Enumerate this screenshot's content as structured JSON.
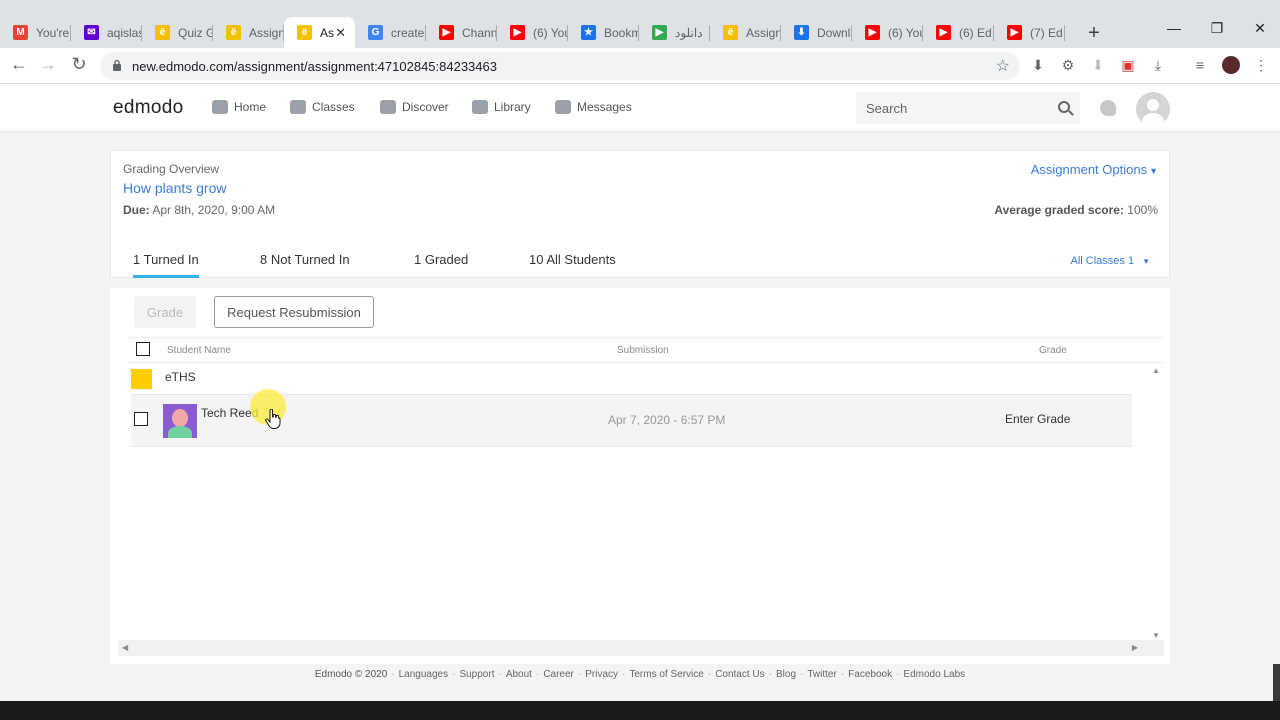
{
  "browser": {
    "tabs": [
      {
        "title": "You're",
        "icon": "gmail-icon",
        "color": "#ea4335",
        "glyph": "M"
      },
      {
        "title": "aqislas",
        "icon": "yahoo-mail-icon",
        "color": "#6001d2",
        "glyph": "✉"
      },
      {
        "title": "Quiz G",
        "icon": "edmodo-icon",
        "color": "#f2c200",
        "glyph": "ë"
      },
      {
        "title": "Assign",
        "icon": "edmodo-icon",
        "color": "#f2c200",
        "glyph": "ë"
      },
      {
        "title": "As",
        "icon": "edmodo-icon",
        "color": "#f2c200",
        "glyph": "ë",
        "active": true
      },
      {
        "title": "create",
        "icon": "google-icon",
        "color": "#4285f4",
        "glyph": "G"
      },
      {
        "title": "Chann",
        "icon": "youtube-icon",
        "color": "#ff0000",
        "glyph": "▶"
      },
      {
        "title": "(6) You",
        "icon": "youtube-icon",
        "color": "#ff0000",
        "glyph": "▶"
      },
      {
        "title": "Bookm",
        "icon": "bookmark-star-icon",
        "color": "#1a73e8",
        "glyph": "★"
      },
      {
        "title": "دانلود",
        "icon": "play-store-icon",
        "color": "#34a853",
        "glyph": "▶"
      },
      {
        "title": "Assign",
        "icon": "edmodo-icon",
        "color": "#f2c200",
        "glyph": "ë"
      },
      {
        "title": "Downl",
        "icon": "download-icon",
        "color": "#1a73e8",
        "glyph": "⬇"
      },
      {
        "title": "(6) You",
        "icon": "youtube-icon",
        "color": "#ff0000",
        "glyph": "▶"
      },
      {
        "title": "(6) Ed",
        "icon": "youtube-icon",
        "color": "#ff0000",
        "glyph": "▶"
      },
      {
        "title": "(7) Ed",
        "icon": "youtube-icon",
        "color": "#ff0000",
        "glyph": "▶"
      }
    ],
    "new_tab": "+",
    "minimize": "—",
    "restore": "❐",
    "close": "✕",
    "back": "←",
    "forward": "→",
    "reload": "↻",
    "url": "new.edmodo.com/assignment/assignment:47102845:84233463",
    "star": "☆",
    "menu": "⋮"
  },
  "header": {
    "logo": "edmodo",
    "nav": [
      {
        "label": "Home",
        "icon": "home-icon"
      },
      {
        "label": "Classes",
        "icon": "classes-icon"
      },
      {
        "label": "Discover",
        "icon": "discover-icon"
      },
      {
        "label": "Library",
        "icon": "library-icon"
      },
      {
        "label": "Messages",
        "icon": "messages-icon"
      }
    ],
    "search_placeholder": "Search"
  },
  "overview": {
    "label": "Grading Overview",
    "assignment_title": "How plants grow",
    "due_label": "Due:",
    "due_value": "Apr 8th, 2020, 9:00 AM",
    "options": "Assignment Options",
    "avg_label": "Average graded score:",
    "avg_value": "100%",
    "tabs": [
      {
        "label": "1 Turned In",
        "active": true
      },
      {
        "label": "8 Not Turned In"
      },
      {
        "label": "1 Graded"
      },
      {
        "label": "10 All Students"
      }
    ],
    "class_filter": "All Classes  1"
  },
  "list": {
    "grade_button": "Grade",
    "resubmit_button": "Request Resubmission",
    "columns": {
      "name": "Student Name",
      "submission": "Submission",
      "grade": "Grade"
    },
    "group": {
      "name": "eTHS",
      "color": "#ffcc00"
    },
    "rows": [
      {
        "name": "Tech Reed",
        "submission": "Apr 7, 2020 - 6:57 PM",
        "grade_action": "Enter Grade"
      }
    ]
  },
  "footer": {
    "copyright": "Edmodo © 2020",
    "links": [
      "Languages",
      "Support",
      "About",
      "Career",
      "Privacy",
      "Terms of Service",
      "Contact Us",
      "Blog",
      "Twitter",
      "Facebook",
      "Edmodo Labs"
    ]
  }
}
